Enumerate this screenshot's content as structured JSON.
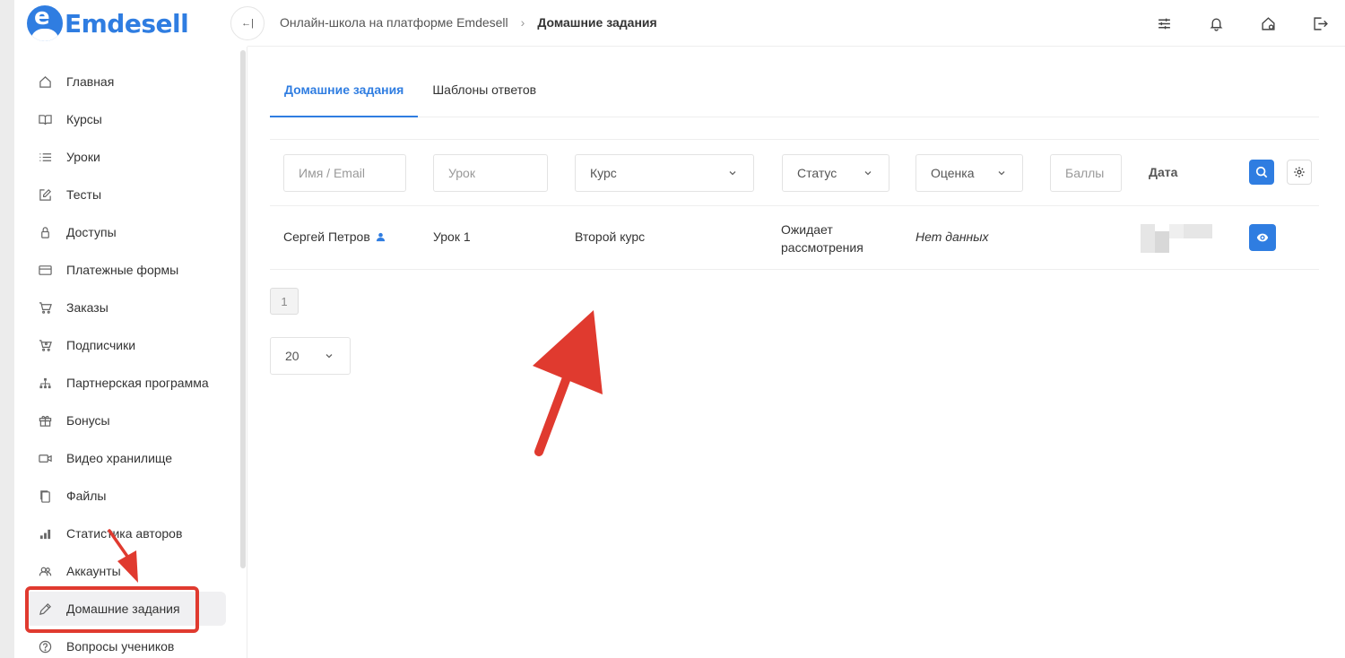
{
  "brand": {
    "name": "Emdesell",
    "logo_letter": "e",
    "color": "#2f7de1"
  },
  "sidebar": {
    "items": [
      {
        "label": "Главная",
        "icon": "home-icon"
      },
      {
        "label": "Курсы",
        "icon": "book-icon"
      },
      {
        "label": "Уроки",
        "icon": "list-icon"
      },
      {
        "label": "Тесты",
        "icon": "edit-square-icon"
      },
      {
        "label": "Доступы",
        "icon": "lock-icon"
      },
      {
        "label": "Платежные формы",
        "icon": "credit-card-icon"
      },
      {
        "label": "Заказы",
        "icon": "cart-icon"
      },
      {
        "label": "Подписчики",
        "icon": "cart-person-icon"
      },
      {
        "label": "Партнерская программа",
        "icon": "hierarchy-icon"
      },
      {
        "label": "Бонусы",
        "icon": "gift-icon"
      },
      {
        "label": "Видео хранилище",
        "icon": "video-icon"
      },
      {
        "label": "Файлы",
        "icon": "files-icon"
      },
      {
        "label": "Статистика авторов",
        "icon": "bar-chart-icon"
      },
      {
        "label": "Аккаунты",
        "icon": "users-icon"
      },
      {
        "label": "Домашние задания",
        "icon": "pencil-icon",
        "active": true
      },
      {
        "label": "Вопросы учеников",
        "icon": "question-circle-icon"
      }
    ]
  },
  "header": {
    "collapse_label": "←|",
    "breadcrumb": {
      "root": "Онлайн-школа на платформе Emdesell",
      "separator": "›",
      "current": "Домашние задания"
    },
    "icons": [
      "sliders-icon",
      "bell-icon",
      "home-settings-icon",
      "logout-icon"
    ]
  },
  "tabs": [
    {
      "label": "Домашние задания",
      "active": true
    },
    {
      "label": "Шаблоны ответов",
      "active": false
    }
  ],
  "filters": {
    "name_placeholder": "Имя / Email",
    "lesson_placeholder": "Урок",
    "course_select": "Курс",
    "status_select": "Статус",
    "grade_select": "Оценка",
    "points_placeholder": "Баллы",
    "date_label": "Дата"
  },
  "rows": [
    {
      "name": "Сергей Петров",
      "lesson": "Урок 1",
      "course": "Второй курс",
      "status_line1": "Ожидает",
      "status_line2": "рассмотрения",
      "grade": "Нет данных"
    }
  ],
  "pagination": {
    "current_page": "1",
    "per_page": "20"
  },
  "colors": {
    "accent": "#2f7de1",
    "annotation": "#e03a2f"
  }
}
